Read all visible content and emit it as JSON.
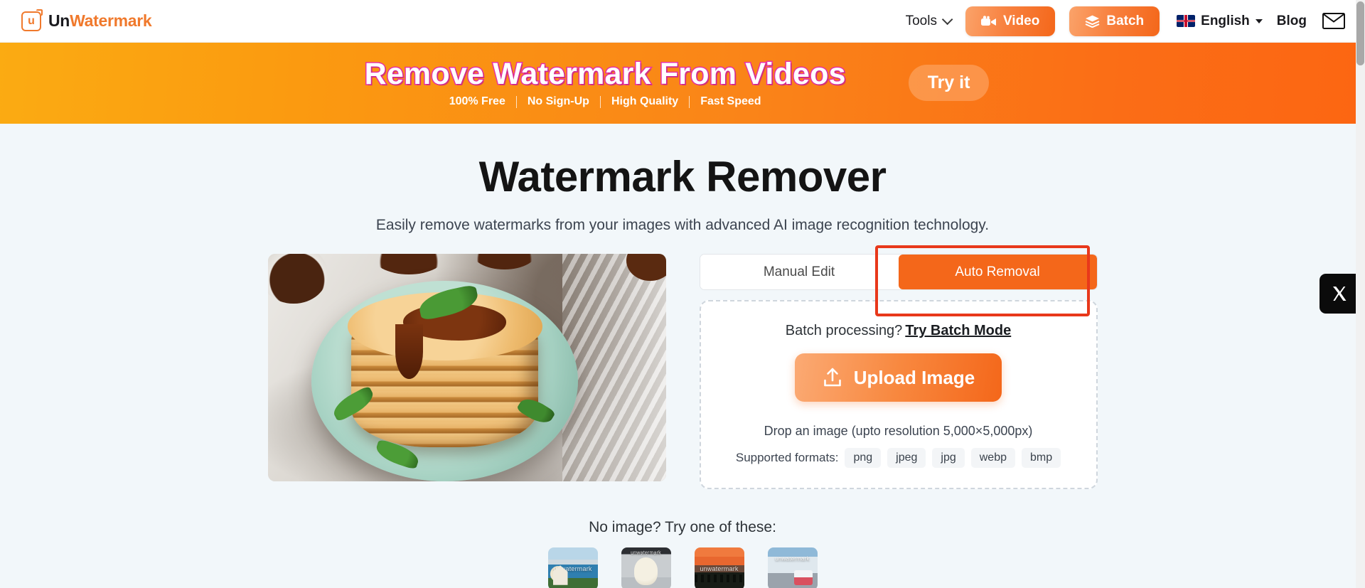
{
  "header": {
    "logo": {
      "part1": "Un",
      "part2": "Watermark",
      "mark_letter": "u",
      "icon": "logo-mark-icon"
    },
    "tools_label": "Tools",
    "video_label": "Video",
    "batch_label": "Batch",
    "language": "English",
    "blog_label": "Blog",
    "mail_icon": "envelope-icon"
  },
  "banner": {
    "title": "Remove Watermark From Videos",
    "features": [
      "100% Free",
      "No Sign-Up",
      "High Quality",
      "Fast Speed"
    ],
    "cta": "Try it"
  },
  "main": {
    "heading": "Watermark Remover",
    "subheading": "Easily remove watermarks from your images with advanced AI image recognition technology."
  },
  "tabs": [
    {
      "label": "Manual Edit",
      "active": false
    },
    {
      "label": "Auto Removal",
      "active": true
    }
  ],
  "dropzone": {
    "batch_prompt": "Batch processing?",
    "batch_link": "Try Batch Mode",
    "upload_label": "Upload Image",
    "upload_icon": "upload-arrow-icon",
    "drop_hint": "Drop an image (upto resolution 5,000×5,000px)",
    "formats_label": "Supported formats:",
    "formats": [
      "png",
      "jpeg",
      "jpg",
      "webp",
      "bmp"
    ]
  },
  "samples": {
    "title": "No image? Try one of these:",
    "items": [
      {
        "name": "sample-house-coast",
        "watermark": "unwatermark"
      },
      {
        "name": "sample-cat",
        "watermark": "unwatermark"
      },
      {
        "name": "sample-sunset-crowd",
        "watermark": "unwatermark"
      },
      {
        "name": "sample-bus-mountains",
        "watermark": "unwatermark"
      }
    ]
  },
  "floating": {
    "x_label": "X",
    "x_icon": "x-social-icon"
  },
  "colors": {
    "accent_orange": "#f4671a",
    "banner_start": "#fbab12",
    "banner_end": "#fc6612",
    "highlight_red": "#e8381b",
    "page_bg": "#f2f7fa"
  }
}
